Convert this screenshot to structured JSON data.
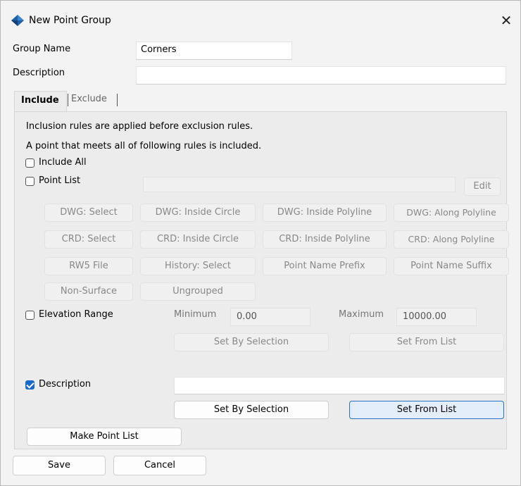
{
  "window": {
    "title": "New Point Group",
    "close_glyph": "✕",
    "app_icon": "blue-diamond-icon"
  },
  "form": {
    "group_name_label": "Group Name",
    "group_name_value": "Corners",
    "description_label": "Description",
    "description_value": ""
  },
  "tabs": [
    {
      "label": "Include",
      "active": true
    },
    {
      "label": "Exclude",
      "active": false
    }
  ],
  "include": {
    "info_line1": "Inclusion rules are applied before exclusion rules.",
    "info_line2": "A point that meets all of following rules is included.",
    "include_all": {
      "label": "Include All",
      "checked": false
    },
    "point_list": {
      "label": "Point List",
      "checked": false,
      "value": "",
      "edit_label": "Edit"
    },
    "rule_buttons": [
      [
        "DWG: Select",
        "DWG: Inside Circle",
        "DWG: Inside Polyline",
        "DWG: Along Polyline"
      ],
      [
        "CRD: Select",
        "CRD: Inside Circle",
        "CRD: Inside Polyline",
        "CRD: Along Polyline"
      ],
      [
        "RW5 File",
        "History: Select",
        "Point Name Prefix",
        "Point Name Suffix"
      ],
      [
        "Non-Surface",
        "Ungrouped"
      ]
    ],
    "elevation_range": {
      "label": "Elevation Range",
      "checked": false,
      "min_label": "Minimum",
      "min_value": "0.00",
      "max_label": "Maximum",
      "max_value": "10000.00",
      "set_by_selection": "Set By Selection",
      "set_from_list": "Set From List"
    },
    "description_rule": {
      "label": "Description",
      "checked": true,
      "value": "",
      "set_by_selection": "Set By Selection",
      "set_from_list": "Set From List"
    },
    "make_point_list": "Make Point List"
  },
  "footer": {
    "save_label": "Save",
    "cancel_label": "Cancel"
  },
  "colors": {
    "accent": "#1769c6",
    "app_icon": "#1f5fa8"
  }
}
